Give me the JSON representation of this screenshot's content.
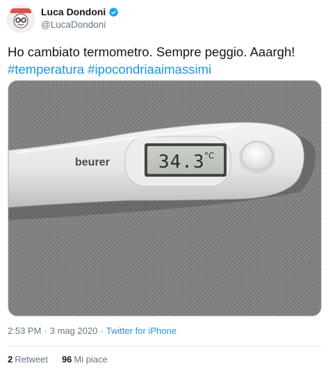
{
  "author": {
    "display_name": "Luca Dondoni",
    "handle": "@LucaDondoni",
    "verified": true,
    "verified_color": "#1da1f2"
  },
  "tweet": {
    "text_line1": "Ho cambiato termometro. Sempre peggio. Aaargh!",
    "hashtags": [
      "#temperatura",
      "#ipocondriaaimassimi"
    ],
    "hashtag_color": "#1b95e0"
  },
  "media": {
    "brand": "beurer",
    "reading": "34.3",
    "unit": "°C"
  },
  "meta": {
    "time": "2:53 PM",
    "separator1": "·",
    "date": "3 mag 2020",
    "separator2": "·",
    "source": "Twitter for iPhone"
  },
  "stats": {
    "retweets_count": "2",
    "retweets_label": "Retweet",
    "likes_count": "96",
    "likes_label": "Mi piace"
  }
}
